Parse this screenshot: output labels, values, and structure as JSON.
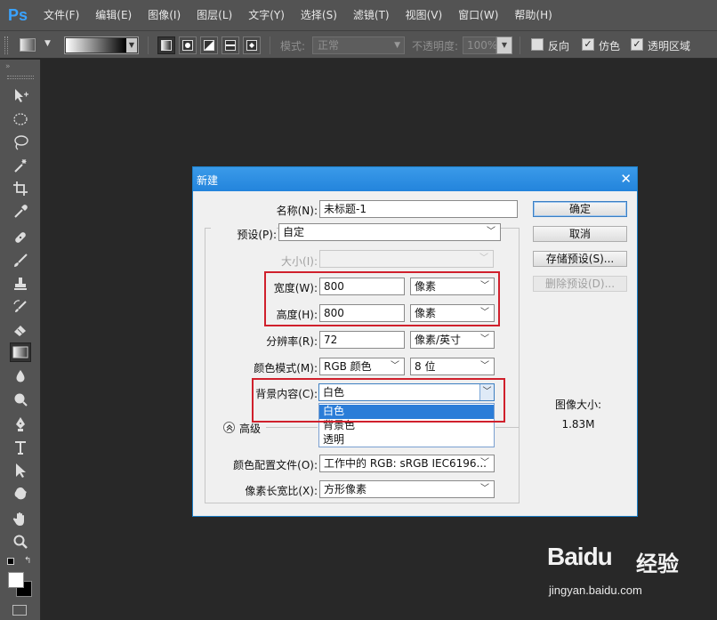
{
  "app": {
    "logo": "Ps",
    "menus": [
      "文件(F)",
      "编辑(E)",
      "图像(I)",
      "图层(L)",
      "文字(Y)",
      "选择(S)",
      "滤镜(T)",
      "视图(V)",
      "窗口(W)",
      "帮助(H)"
    ]
  },
  "options_bar": {
    "mode_label": "模式:",
    "mode_value": "正常",
    "opacity_label": "不透明度:",
    "opacity_value": "100%",
    "reverse_label": "反向",
    "reverse_checked": false,
    "dither_label": "仿色",
    "dither_checked": true,
    "transparency_label": "透明区域",
    "transparency_checked": true,
    "gradient_from": "#ffffff",
    "gradient_to": "#000000"
  },
  "toolbar": {
    "collapse_glyph": "»",
    "tools": [
      "move-tool",
      "marquee-tool",
      "lasso-tool",
      "magic-wand-tool",
      "crop-tool",
      "eyedropper-tool",
      "healing-tool",
      "brush-tool",
      "stamp-tool",
      "history-brush-tool",
      "eraser-tool",
      "gradient-tool",
      "blur-tool",
      "dodge-tool",
      "pen-tool",
      "type-tool",
      "path-select-tool",
      "shape-tool",
      "hand-tool",
      "zoom-tool"
    ],
    "active_tool": "gradient-tool",
    "foreground": "#ffffff",
    "background": "#000000"
  },
  "dialog": {
    "title": "新建",
    "name_label": "名称(N):",
    "name_value": "未标题-1",
    "preset_label": "预设(P):",
    "preset_value": "自定",
    "size_label": "大小(I):",
    "width_label": "宽度(W):",
    "width_value": "800",
    "width_unit": "像素",
    "height_label": "高度(H):",
    "height_value": "800",
    "height_unit": "像素",
    "resolution_label": "分辨率(R):",
    "resolution_value": "72",
    "resolution_unit": "像素/英寸",
    "color_mode_label": "颜色模式(M):",
    "color_mode_value": "RGB 颜色",
    "bit_depth_value": "8 位",
    "bg_content_label": "背景内容(C):",
    "bg_content_value": "白色",
    "bg_options": [
      "白色",
      "背景色",
      "透明"
    ],
    "bg_selected_index": 0,
    "advanced_label": "高级",
    "color_profile_label": "颜色配置文件(O):",
    "color_profile_value": "工作中的 RGB: sRGB IEC6196...",
    "pixel_aspect_label": "像素长宽比(X):",
    "pixel_aspect_value": "方形像素",
    "ok_label": "确定",
    "cancel_label": "取消",
    "save_preset_label": "存储预设(S)...",
    "delete_preset_label": "删除预设(D)...",
    "image_size_label": "图像大小:",
    "image_size_value": "1.83M"
  },
  "watermark": {
    "logo": "Baidu",
    "jingyan": "经验",
    "url": "jingyan.baidu.com"
  }
}
